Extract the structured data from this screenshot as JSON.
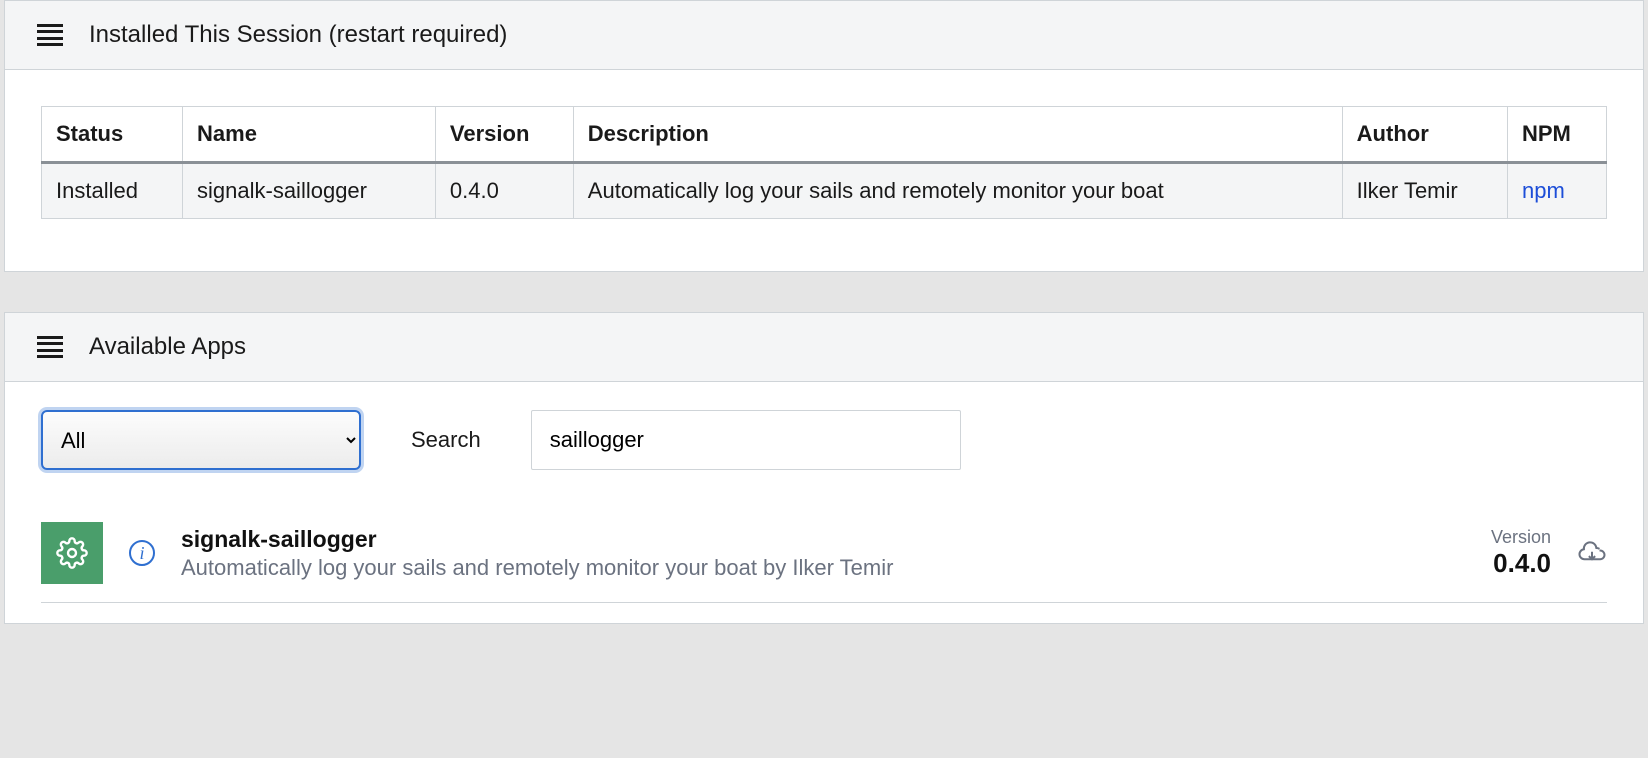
{
  "installed_panel": {
    "title": "Installed This Session (restart required)",
    "columns": {
      "status": "Status",
      "name": "Name",
      "version": "Version",
      "description": "Description",
      "author": "Author",
      "npm": "NPM"
    },
    "rows": [
      {
        "status": "Installed",
        "name": "signalk-saillogger",
        "version": "0.4.0",
        "description": "Automatically log your sails and remotely monitor your boat",
        "author": "Ilker Temir",
        "npm": "npm"
      }
    ]
  },
  "available_panel": {
    "title": "Available Apps",
    "filter_selected": "All",
    "search_label": "Search",
    "search_value": "saillogger",
    "apps": [
      {
        "icon": "gear-icon",
        "name": "signalk-saillogger",
        "description": "Automatically log your sails and remotely monitor your boat by Ilker Temir",
        "version_label": "Version",
        "version": "0.4.0"
      }
    ]
  }
}
